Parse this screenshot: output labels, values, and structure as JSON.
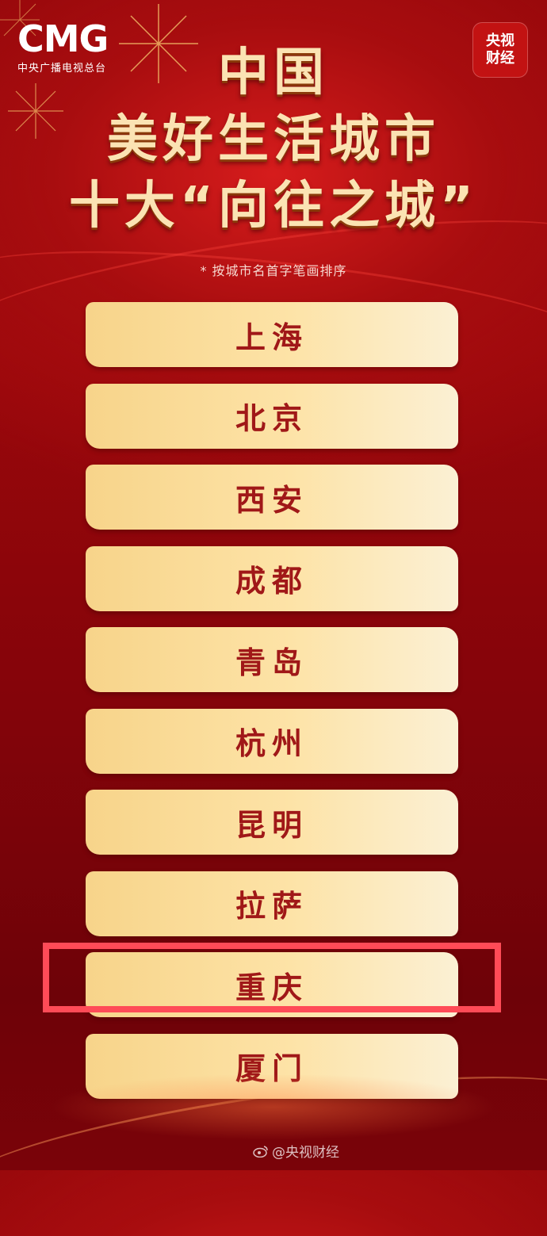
{
  "header": {
    "logo_mark": "CMG",
    "logo_subtitle": "中央广播电视总台",
    "badge_line1": "央视",
    "badge_line2": "财经"
  },
  "title": {
    "line1": "中国",
    "line2": "美好生活城市",
    "line3": "十大“向往之城”"
  },
  "note": "* 按城市名首字笔画排序",
  "cities": [
    "上海",
    "北京",
    "西安",
    "成都",
    "青岛",
    "杭州",
    "昆明",
    "拉萨",
    "重庆",
    "厦门"
  ],
  "highlighted_city": "重庆",
  "highlight_color": "#ff4b57",
  "watermark": {
    "icon": "weibo-icon",
    "text": "@央视财经"
  }
}
